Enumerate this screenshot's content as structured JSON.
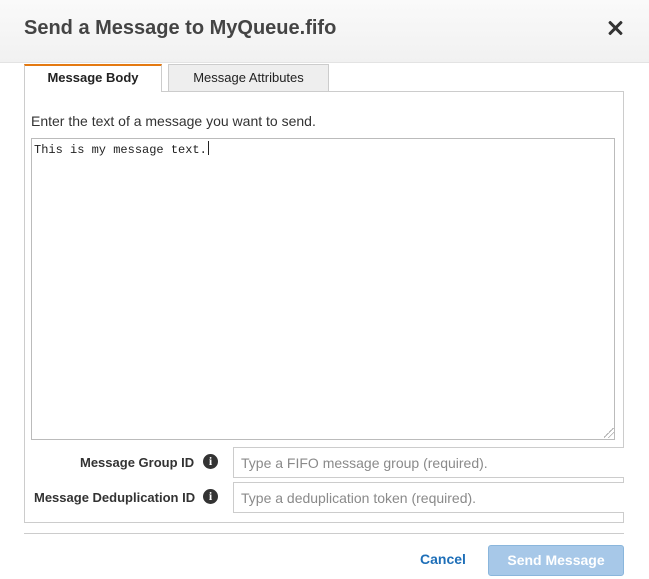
{
  "dialog": {
    "title": "Send a Message to MyQueue.fifo",
    "close_icon": "close-icon"
  },
  "tabs": [
    {
      "label": "Message Body",
      "active": true
    },
    {
      "label": "Message Attributes",
      "active": false
    }
  ],
  "body": {
    "instructions": "Enter the text of a message you want to send.",
    "message_text": "This is my message text."
  },
  "fields": {
    "group_id": {
      "label": "Message Group ID",
      "placeholder": "Type a FIFO message group (required).",
      "value": "",
      "icon": "info-icon"
    },
    "dedup_id": {
      "label": "Message Deduplication ID",
      "placeholder": "Type a deduplication token (required).",
      "value": "",
      "icon": "info-icon"
    }
  },
  "footer": {
    "cancel_label": "Cancel",
    "send_label": "Send Message"
  },
  "colors": {
    "active_tab_accent": "#e47911",
    "link_blue": "#1e6fb8",
    "send_button_disabled": "#a7c8e8"
  }
}
